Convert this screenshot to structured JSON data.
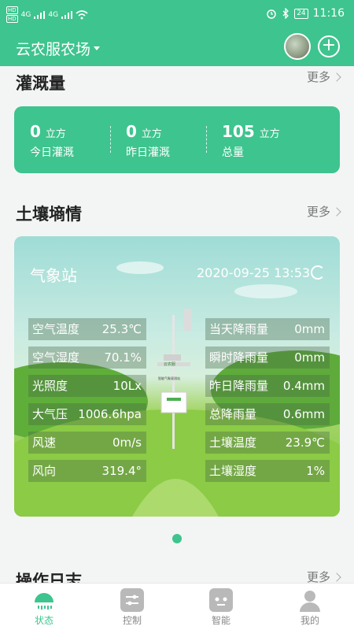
{
  "status_bar": {
    "time": "11:16",
    "battery": "24",
    "sim1": "HD",
    "sim2": "HD",
    "signal_label": "4G"
  },
  "header": {
    "farm_name": "云农服农场"
  },
  "irrigation": {
    "title": "灌溉量",
    "more": "更多",
    "items": [
      {
        "value": "0",
        "unit": "立方",
        "label": "今日灌溉"
      },
      {
        "value": "0",
        "unit": "立方",
        "label": "昨日灌溉"
      },
      {
        "value": "105",
        "unit": "立方",
        "label": "总量"
      }
    ]
  },
  "soil": {
    "title": "土壤墒情",
    "more": "更多"
  },
  "weather_station": {
    "title": "气象站",
    "datetime": "2020-09-25 13:53",
    "left": [
      {
        "label": "空气温度",
        "value": "25.3℃"
      },
      {
        "label": "空气湿度",
        "value": "70.1%"
      },
      {
        "label": "光照度",
        "value": "10Lx"
      },
      {
        "label": "大气压",
        "value": "1006.6hpa"
      },
      {
        "label": "风速",
        "value": "0m/s"
      },
      {
        "label": "风向",
        "value": "319.4°"
      }
    ],
    "right": [
      {
        "label": "当天降雨量",
        "value": "0mm"
      },
      {
        "label": "瞬时降雨量",
        "value": "0mm"
      },
      {
        "label": "昨日降雨量",
        "value": "0.4mm"
      },
      {
        "label": "总降雨量",
        "value": "0.6mm"
      },
      {
        "label": "土壤温度",
        "value": "23.9℃"
      },
      {
        "label": "土壤湿度",
        "value": "1%"
      }
    ],
    "device_sign": "云农服",
    "device_caption": "智能气象观测站"
  },
  "log": {
    "title": "操作日志",
    "more": "更多"
  },
  "tabs": [
    {
      "label": "状态",
      "icon": "status-icon"
    },
    {
      "label": "控制",
      "icon": "control-icon"
    },
    {
      "label": "智能",
      "icon": "robot-icon"
    },
    {
      "label": "我的",
      "icon": "user-icon"
    }
  ],
  "colors": {
    "accent": "#3ec48e"
  }
}
